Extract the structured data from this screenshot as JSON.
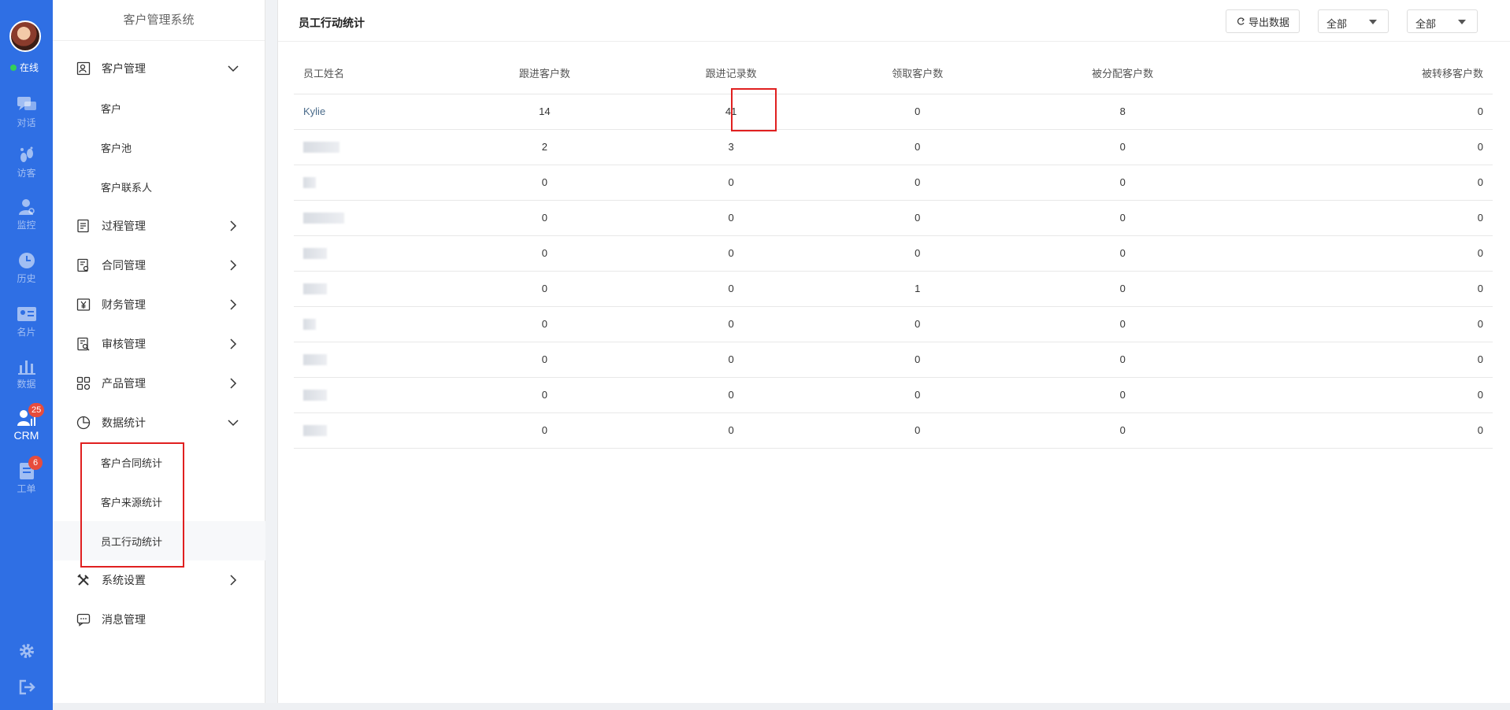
{
  "rail": {
    "status": "在线",
    "items": [
      {
        "label": "对话",
        "icon": "chat-icon"
      },
      {
        "label": "访客",
        "icon": "footprint-icon"
      },
      {
        "label": "监控",
        "icon": "monitor-user-icon"
      },
      {
        "label": "历史",
        "icon": "clock-icon"
      },
      {
        "label": "名片",
        "icon": "card-icon"
      },
      {
        "label": "数据",
        "icon": "bar-chart-icon"
      },
      {
        "label": "CRM",
        "icon": "crm-icon",
        "badge": "25"
      },
      {
        "label": "工单",
        "icon": "ticket-icon",
        "badge": "6"
      }
    ],
    "colors": {
      "rail": "#2f6fe4",
      "badge": "#e74c3c",
      "online": "#34d058"
    }
  },
  "menu": {
    "title": "客户管理系统",
    "items": [
      {
        "label": "客户管理",
        "icon": "customer-icon"
      },
      {
        "label": "过程管理",
        "icon": "process-icon"
      },
      {
        "label": "合同管理",
        "icon": "contract-icon"
      },
      {
        "label": "财务管理",
        "icon": "finance-icon"
      },
      {
        "label": "审核管理",
        "icon": "audit-icon"
      },
      {
        "label": "产品管理",
        "icon": "product-icon"
      },
      {
        "label": "数据统计",
        "icon": "pie-chart-icon"
      },
      {
        "label": "系统设置",
        "icon": "tools-icon"
      },
      {
        "label": "消息管理",
        "icon": "message-icon"
      }
    ],
    "customer_sub": [
      "客户",
      "客户池",
      "客户联系人"
    ],
    "stats_sub": [
      "客户合同统计",
      "客户来源统计",
      "员工行动统计"
    ]
  },
  "content": {
    "title": "员工行动统计",
    "export_label": "导出数据",
    "filter1": "全部",
    "filter2": "全部",
    "columns": [
      "员工姓名",
      "跟进客户数",
      "跟进记录数",
      "领取客户数",
      "被分配客户数",
      "被转移客户数"
    ],
    "rows": [
      [
        "Kylie",
        "14",
        "41",
        "0",
        "8",
        "0"
      ],
      [
        "",
        "2",
        "3",
        "0",
        "0",
        "0"
      ],
      [
        "",
        "0",
        "0",
        "0",
        "0",
        "0"
      ],
      [
        "",
        "0",
        "0",
        "0",
        "0",
        "0"
      ],
      [
        "",
        "0",
        "0",
        "0",
        "0",
        "0"
      ],
      [
        "",
        "0",
        "0",
        "1",
        "0",
        "0"
      ],
      [
        "",
        "0",
        "0",
        "0",
        "0",
        "0"
      ],
      [
        "",
        "0",
        "0",
        "0",
        "0",
        "0"
      ],
      [
        "",
        "0",
        "0",
        "0",
        "0",
        "0"
      ],
      [
        "",
        "0",
        "0",
        "0",
        "0",
        "0"
      ]
    ]
  }
}
